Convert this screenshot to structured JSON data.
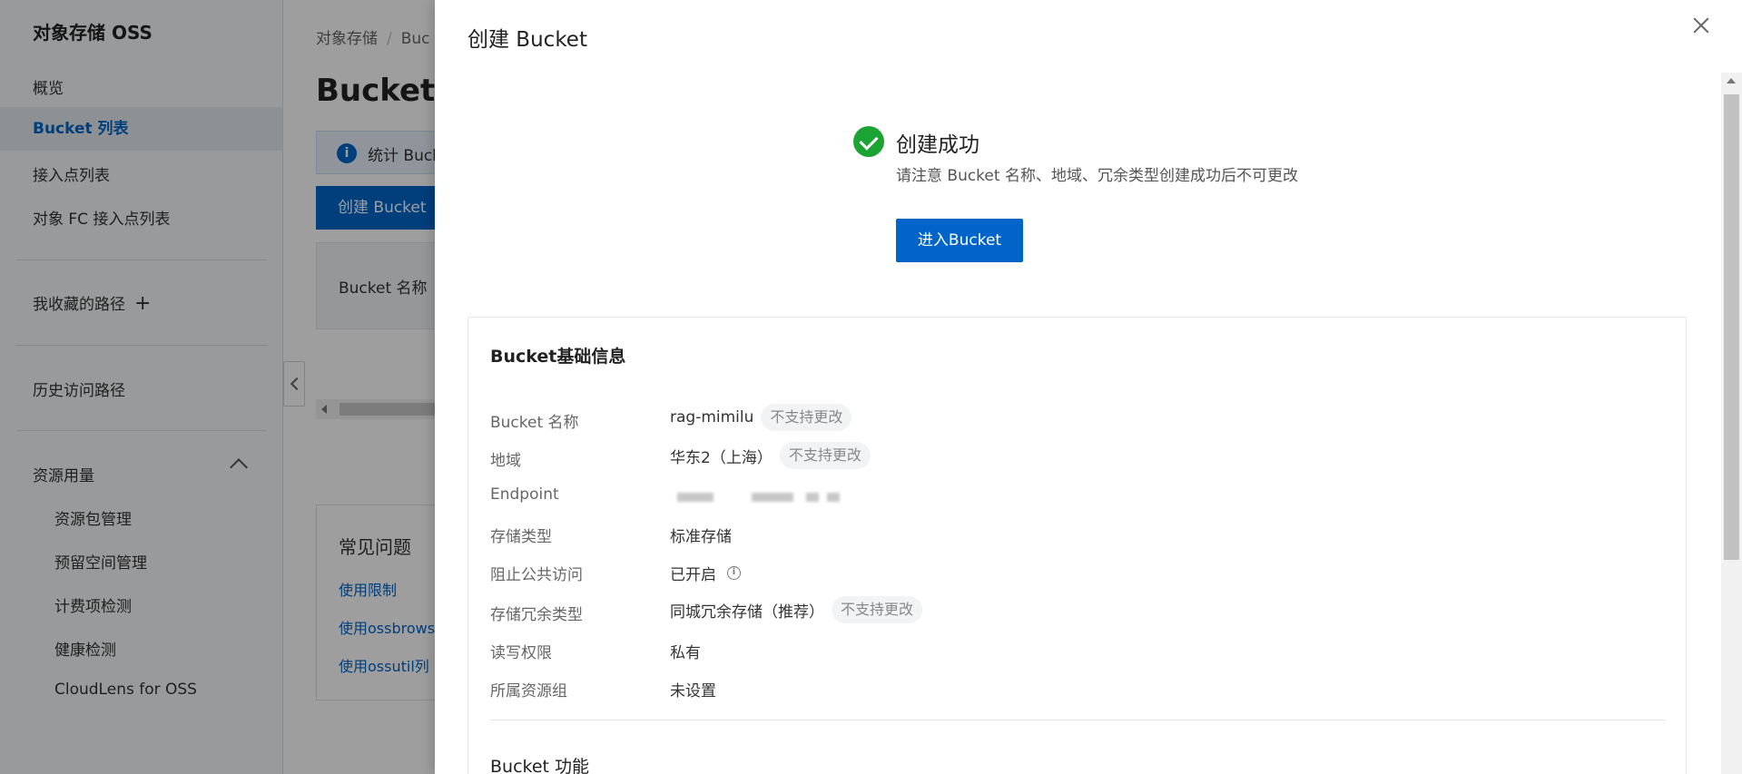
{
  "sidebar": {
    "title": "对象存储 OSS",
    "items": [
      {
        "label": "概览"
      },
      {
        "label": "Bucket 列表"
      },
      {
        "label": "接入点列表"
      },
      {
        "label": "对象 FC 接入点列表"
      }
    ],
    "favorites_label": "我收藏的路径",
    "favorites_add_icon": "plus-icon",
    "history_label": "历史访问路径",
    "resource_label": "资源用量",
    "resource_subitems": [
      {
        "label": "资源包管理"
      },
      {
        "label": "预留空间管理"
      },
      {
        "label": "计费项检测"
      },
      {
        "label": "健康检测"
      },
      {
        "label": "CloudLens for OSS"
      }
    ]
  },
  "main": {
    "breadcrumb": [
      "对象存储",
      "Buc"
    ],
    "page_title": "Bucket 列",
    "info_text": "统计 Buck",
    "create_button": "创建 Bucket",
    "filter_label": "Bucket 名称",
    "faq": {
      "title": "常见问题",
      "links": [
        "使用限制",
        "使用ossbrows",
        "使用ossutil列"
      ]
    }
  },
  "drawer": {
    "title": "创建 Bucket",
    "success_title": "创建成功",
    "success_desc": "请注意 Bucket 名称、地域、冗余类型创建成功后不可更改",
    "enter_button": "进入Bucket",
    "card_title": "Bucket基础信息",
    "rows": [
      {
        "label": "Bucket 名称",
        "value": "rag-mimilu",
        "tag": "不支持更改"
      },
      {
        "label": "地域",
        "value": "华东2（上海）",
        "tag": "不支持更改"
      },
      {
        "label": "Endpoint",
        "value": ""
      },
      {
        "label": "存储类型",
        "value": "标准存储"
      },
      {
        "label": "阻止公共访问",
        "value": "已开启"
      },
      {
        "label": "存储冗余类型",
        "value": "同城冗余存储（推荐）",
        "tag": "不支持更改"
      },
      {
        "label": "读写权限",
        "value": "私有"
      },
      {
        "label": "所属资源组",
        "value": "未设置"
      }
    ],
    "next_section_title": "Bucket 功能"
  },
  "colors": {
    "primary": "#0064c8",
    "success": "#1ba333",
    "overlay": "rgba(0,0,0,0.38)"
  }
}
